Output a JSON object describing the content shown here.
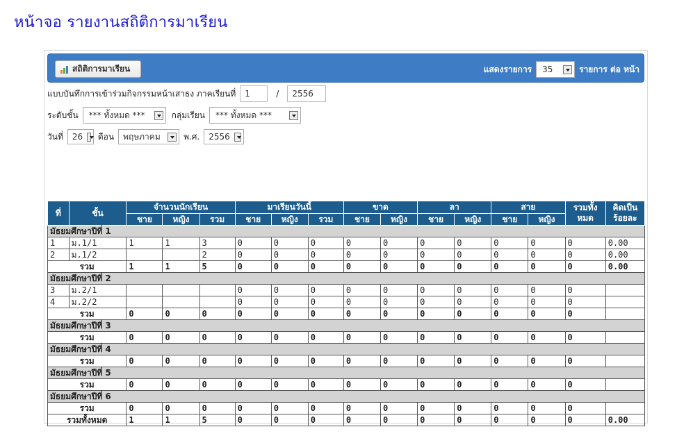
{
  "page": {
    "title": "หน้าจอ รายงานสถิติการมาเรียน"
  },
  "header": {
    "button_label": "สถิติการมาเรียน",
    "button_icon": "chart-icon",
    "show_label": "แสดงรายการ",
    "per_page_value": "35",
    "per_page_suffix": "รายการ ต่อ หน้า",
    "bg_color": "#3e7cc6"
  },
  "filters": {
    "record_label": "แบบบันทึกการเข้าร่วมกิจกรรมหน้าเสาธง ภาคเรียนที่",
    "semester_value": "1",
    "slash": "/",
    "year_value": "2556",
    "level_label": "ระดับชั้น",
    "level_value": "*** ทั้งหมด ***",
    "group_label": "กลุ่มเรียน",
    "group_value": "*** ทั้งหมด ***",
    "day_label": "วันที่",
    "day_value": "26",
    "month_label": "ดือน",
    "month_value": "พฤษภาคม",
    "be_label": "พ.ศ.",
    "be_value": "2556"
  },
  "table": {
    "header_color": "#1c5d8e",
    "h_no": "ที่",
    "h_class": "ชั้น",
    "h_students": "จำนวนนักเรียน",
    "h_present": "มาเรียนวันนี้",
    "h_absent": "ขาด",
    "h_leave": "ลา",
    "h_late": "สาย",
    "h_total_all": "รวมทั้ง หมด",
    "h_percent": "คิดเป็น ร้อยละ",
    "sub": {
      "male": "ชาย",
      "female": "หญิง",
      "total": "รวม"
    },
    "sum_label": "รวม",
    "grand_label": "รวมทั้งหมด",
    "groups": [
      {
        "name": "มัธยมศึกษาปีที่ 1",
        "rows": [
          {
            "no": "1",
            "cls": "ม.1/1",
            "v": [
              "1",
              "1",
              "3",
              "0",
              "0",
              "0",
              "0",
              "0",
              "0",
              "0",
              "0",
              "0",
              "0",
              "0.00"
            ]
          },
          {
            "no": "2",
            "cls": "ม.1/2",
            "v": [
              "",
              "",
              "2",
              "0",
              "0",
              "0",
              "0",
              "0",
              "0",
              "0",
              "0",
              "0",
              "0",
              "0.00"
            ]
          }
        ],
        "sum": [
          "1",
          "1",
          "5",
          "0",
          "0",
          "0",
          "0",
          "0",
          "0",
          "0",
          "0",
          "0",
          "0",
          "0.00"
        ]
      },
      {
        "name": "มัธยมศึกษาปีที่ 2",
        "rows": [
          {
            "no": "3",
            "cls": "ม.2/1",
            "v": [
              "",
              "",
              "",
              "0",
              "0",
              "0",
              "0",
              "0",
              "0",
              "0",
              "0",
              "0",
              "0",
              ""
            ]
          },
          {
            "no": "4",
            "cls": "ม.2/2",
            "v": [
              "",
              "",
              "",
              "0",
              "0",
              "0",
              "0",
              "0",
              "0",
              "0",
              "0",
              "0",
              "0",
              ""
            ]
          }
        ],
        "sum": [
          "0",
          "0",
          "0",
          "0",
          "0",
          "0",
          "0",
          "0",
          "0",
          "0",
          "0",
          "0",
          "0",
          ""
        ]
      },
      {
        "name": "มัธยมศึกษาปีที่ 3",
        "rows": [],
        "sum": [
          "0",
          "0",
          "0",
          "0",
          "0",
          "0",
          "0",
          "0",
          "0",
          "0",
          "0",
          "0",
          "0",
          ""
        ]
      },
      {
        "name": "มัธยมศึกษาปีที่ 4",
        "rows": [],
        "sum": [
          "0",
          "0",
          "0",
          "0",
          "0",
          "0",
          "0",
          "0",
          "0",
          "0",
          "0",
          "0",
          "0",
          ""
        ]
      },
      {
        "name": "มัธยมศึกษาปีที่ 5",
        "rows": [],
        "sum": [
          "0",
          "0",
          "0",
          "0",
          "0",
          "0",
          "0",
          "0",
          "0",
          "0",
          "0",
          "0",
          "0",
          ""
        ]
      },
      {
        "name": "มัธยมศึกษาปีที่ 6",
        "rows": [],
        "sum": [
          "0",
          "0",
          "0",
          "0",
          "0",
          "0",
          "0",
          "0",
          "0",
          "0",
          "0",
          "0",
          "0",
          ""
        ]
      }
    ],
    "grand": [
      "1",
      "1",
      "5",
      "0",
      "0",
      "0",
      "0",
      "0",
      "0",
      "0",
      "0",
      "0",
      "0",
      "0.00"
    ]
  }
}
